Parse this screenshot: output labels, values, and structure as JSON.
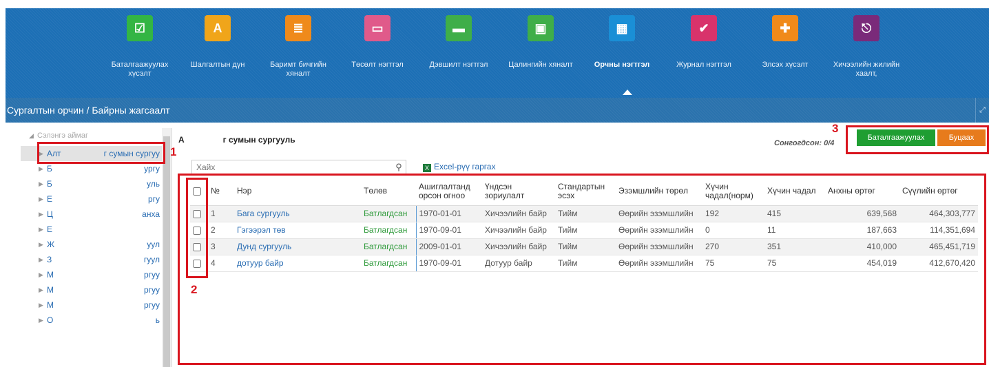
{
  "nav": {
    "items": [
      {
        "label": "Баталгаажуулах хүсэлт",
        "icon": "approve-icon",
        "color": "#33b544"
      },
      {
        "label": "Шалгалтын дүн",
        "icon": "exam-result-icon",
        "color": "#f0a51a"
      },
      {
        "label": "Баримт бичгийн хяналт",
        "icon": "document-icon",
        "color": "#ef8a1b"
      },
      {
        "label": "Төсөлт нэгтгэл",
        "icon": "presentation-icon",
        "color": "#e05a8a"
      },
      {
        "label": "Дэвшилт нэгтгэл",
        "icon": "promotion-icon",
        "color": "#3fae49"
      },
      {
        "label": "Цалингийн хяналт",
        "icon": "salary-icon",
        "color": "#3fae49"
      },
      {
        "label": "Орчны нэгтгэл",
        "icon": "building-icon",
        "color": "#1a8fd6"
      },
      {
        "label": "Журнал нэгтгэл",
        "icon": "journal-icon",
        "color": "#d8336b"
      },
      {
        "label": "Элсэх хүсэлт",
        "icon": "enroll-icon",
        "color": "#f08a1a"
      },
      {
        "label": "Хичээлийн жилийн хаалт,",
        "icon": "exit-icon",
        "color": "#7a2a7a"
      }
    ]
  },
  "breadcrumb": "Сургалтын орчин / Байрны жагсаалт",
  "tree": {
    "root": "Сэлэнгэ аймаг",
    "items": [
      {
        "a": "Алт",
        "b": "г сумын сургуу"
      },
      {
        "a": "Б",
        "b": "ургу"
      },
      {
        "a": "Б",
        "b": "уль"
      },
      {
        "a": "Е",
        "b": "ргу"
      },
      {
        "a": "Ц",
        "b": "анха"
      },
      {
        "a": "Е",
        "b": ""
      },
      {
        "a": "Ж",
        "b": "уул"
      },
      {
        "a": "З",
        "b": "гуул"
      },
      {
        "a": "М",
        "b": "ргуу"
      },
      {
        "a": "М",
        "b": "ргуу"
      },
      {
        "a": "М",
        "b": "ргуу"
      },
      {
        "a": "О",
        "b": "ь"
      }
    ]
  },
  "header": {
    "title_prefix": "А",
    "title_suffix": "г сумын сургууль",
    "selected": "Сонгогдсон: 0/4",
    "confirm": "Баталгаажуулах",
    "back": "Буцаах"
  },
  "toolbar": {
    "search_placeholder": "Хайх",
    "excel": "Excel-рүү гаргах"
  },
  "table": {
    "columns": [
      "№",
      "Нэр",
      "Төлөв",
      "Ашиглалтанд орсон огноо",
      "Үндсэн зориулалт",
      "Стандартын эсэх",
      "Эзэмшлийн төрөл",
      "Хүчин чадал(норм)",
      "Хүчин чадал",
      "Анхны өртөг",
      "Сүүлийн өртөг"
    ],
    "rows": [
      [
        "1",
        "Бага сургууль",
        "Батлагдсан",
        "1970-01-01",
        "Хичээлийн байр",
        "Тийм",
        "Өөрийн эзэмшлийн",
        "192",
        "415",
        "639,568",
        "464,303,777"
      ],
      [
        "2",
        "Гэгээрэл төв",
        "Батлагдсан",
        "1970-09-01",
        "Хичээлийн байр",
        "Тийм",
        "Өөрийн эзэмшлийн",
        "0",
        "11",
        "187,663",
        "114,351,694"
      ],
      [
        "3",
        "Дунд сургууль",
        "Батлагдсан",
        "2009-01-01",
        "Хичээлийн байр",
        "Тийм",
        "Өөрийн эзэмшлийн",
        "270",
        "351",
        "410,000",
        "465,451,719"
      ],
      [
        "4",
        "дотуур байр",
        "Батлагдсан",
        "1970-09-01",
        "Дотуур байр",
        "Тийм",
        "Өөрийн эзэмшлийн",
        "75",
        "75",
        "454,019",
        "412,670,420"
      ]
    ]
  },
  "annotations": {
    "n1": "1",
    "n2": "2",
    "n3": "3"
  }
}
